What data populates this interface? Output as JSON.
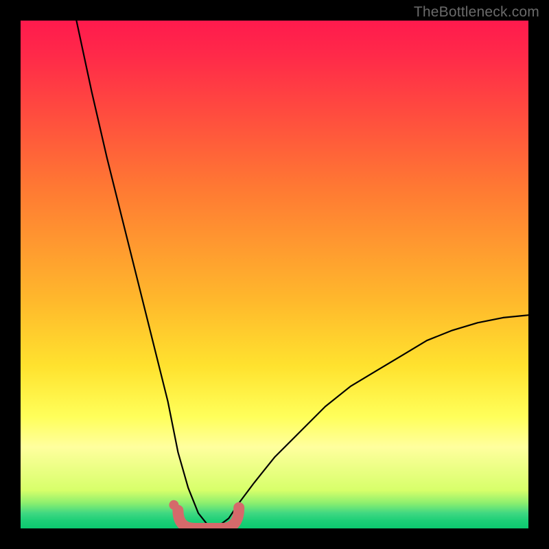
{
  "watermark": "TheBottleneck.com",
  "colors": {
    "frame": "#000000",
    "curve": "#000000",
    "marker": "#d56a6b",
    "gradient_top": "#ff1a4d",
    "gradient_bottom": "#0cc96f"
  },
  "chart_data": {
    "type": "line",
    "title": "",
    "xlabel": "",
    "ylabel": "",
    "xlim": [
      0,
      100
    ],
    "ylim": [
      0,
      100
    ],
    "grid": false,
    "notes": "V-shaped bottleneck curve; y≈100 at x≈min visible (~11), drops to ~0 at the notch (x≈33–40), rises to ~42 at x=100. Small salmon/pink U-shaped marker segment spans roughly x=31..43 near y≈0–3. No axis ticks or numeric labels are shown.",
    "series": [
      {
        "name": "bottleneck-curve",
        "x": [
          11,
          14,
          17,
          20,
          23,
          26,
          29,
          31,
          33,
          35,
          37,
          39,
          41,
          43,
          46,
          50,
          55,
          60,
          65,
          70,
          75,
          80,
          85,
          90,
          95,
          100
        ],
        "y": [
          100,
          86,
          73,
          61,
          49,
          37,
          25,
          15,
          8,
          3,
          0.5,
          0.5,
          2,
          5,
          9,
          14,
          19,
          24,
          28,
          31,
          34,
          37,
          39,
          40.5,
          41.5,
          42
        ]
      }
    ],
    "markers": [
      {
        "name": "notch-segment",
        "shape": "rounded-u",
        "x_range": [
          31,
          43
        ],
        "y_range": [
          0,
          3
        ],
        "color": "#d56a6b"
      }
    ]
  }
}
